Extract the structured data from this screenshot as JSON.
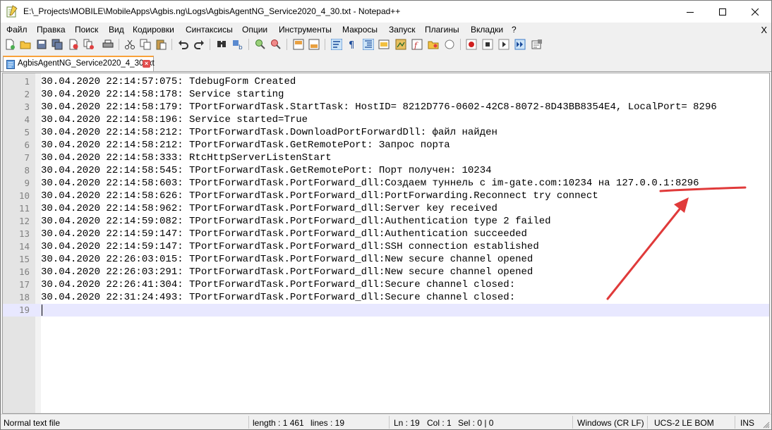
{
  "window": {
    "title": "E:\\_Projects\\MOBILE\\MobileApps\\Agbis.ng\\Logs\\AgbisAgentNG_Service2020_4_30.txt - Notepad++",
    "controls": [
      "minimize",
      "maximize",
      "close"
    ]
  },
  "menu": {
    "items": [
      "Файл",
      "Правка",
      "Поиск",
      "Вид",
      "Кодировки",
      "Синтаксисы",
      "Опции",
      "Инструменты",
      "Макросы",
      "Запуск",
      "Плагины",
      "Вкладки",
      "?"
    ],
    "close_label": "X"
  },
  "toolbar": {
    "icons": [
      "new-file-icon",
      "open-file-icon",
      "save-icon",
      "save-all-icon",
      "close-icon",
      "close-all-icon",
      "print-icon",
      "cut-icon",
      "copy-icon",
      "paste-icon",
      "undo-icon",
      "redo-icon",
      "find-icon",
      "replace-icon",
      "zoom-in-icon",
      "zoom-out-icon",
      "sync-vertical-icon",
      "sync-horizontal-icon",
      "word-wrap-icon",
      "show-all-chars-icon",
      "indent-guide-icon",
      "udl-icon",
      "doc-map-icon",
      "function-list-icon",
      "folder-workspace-icon",
      "monitoring-icon",
      "record-macro-icon",
      "stop-record-icon",
      "play-macro-icon",
      "run-macro-multiple-icon",
      "save-macro-icon"
    ]
  },
  "tabs": [
    {
      "label": "AgbisAgentNG_Service2020_4_30.txt",
      "active": true
    }
  ],
  "editor": {
    "lines": [
      {
        "num": "1",
        "text": "30.04.2020 22:14:57:075: TdebugForm Created"
      },
      {
        "num": "2",
        "text": "30.04.2020 22:14:58:178: Service starting"
      },
      {
        "num": "3",
        "text": "30.04.2020 22:14:58:179: TPortForwardTask.StartTask: HostID= 8212D776-0602-42C8-8072-8D43BB8354E4, LocalPort= 8296"
      },
      {
        "num": "4",
        "text": "30.04.2020 22:14:58:196: Service started=True"
      },
      {
        "num": "5",
        "text": "30.04.2020 22:14:58:212: TPortForwardTask.DownloadPortForwardDll: файл найден"
      },
      {
        "num": "6",
        "text": "30.04.2020 22:14:58:212: TPortForwardTask.GetRemotePort: Запрос порта"
      },
      {
        "num": "7",
        "text": "30.04.2020 22:14:58:333: RtcHttpServerListenStart"
      },
      {
        "num": "8",
        "text": "30.04.2020 22:14:58:545: TPortForwardTask.GetRemotePort: Порт получен: 10234"
      },
      {
        "num": "9",
        "text": "30.04.2020 22:14:58:603: TPortForwardTask.PortForward_dll:Создаем туннель с im-gate.com:10234 на 127.0.0.1:8296"
      },
      {
        "num": "10",
        "text": "30.04.2020 22:14:58:626: TPortForwardTask.PortForward_dll:PortForwarding.Reconnect try connect"
      },
      {
        "num": "11",
        "text": "30.04.2020 22:14:58:962: TPortForwardTask.PortForward_dll:Server key received"
      },
      {
        "num": "12",
        "text": "30.04.2020 22:14:59:082: TPortForwardTask.PortForward_dll:Authentication type 2 failed"
      },
      {
        "num": "13",
        "text": "30.04.2020 22:14:59:147: TPortForwardTask.PortForward_dll:Authentication succeeded"
      },
      {
        "num": "14",
        "text": "30.04.2020 22:14:59:147: TPortForwardTask.PortForward_dll:SSH connection established"
      },
      {
        "num": "15",
        "text": "30.04.2020 22:26:03:015: TPortForwardTask.PortForward_dll:New secure channel opened"
      },
      {
        "num": "16",
        "text": "30.04.2020 22:26:03:291: TPortForwardTask.PortForward_dll:New secure channel opened"
      },
      {
        "num": "17",
        "text": "30.04.2020 22:26:41:304: TPortForwardTask.PortForward_dll:Secure channel closed:"
      },
      {
        "num": "18",
        "text": "30.04.2020 22:31:24:493: TPortForwardTask.PortForward_dll:Secure channel closed:"
      },
      {
        "num": "19",
        "text": ""
      }
    ],
    "current_line": 19
  },
  "annotation": {
    "color": "#e03a3a"
  },
  "status": {
    "file_type": "Normal text file",
    "length": "length : 1 461",
    "lines": "lines : 19",
    "ln": "Ln : 19",
    "col": "Col : 1",
    "sel": "Sel : 0 | 0",
    "eol": "Windows (CR LF)",
    "encoding": "UCS-2 LE BOM",
    "mode": "INS"
  }
}
